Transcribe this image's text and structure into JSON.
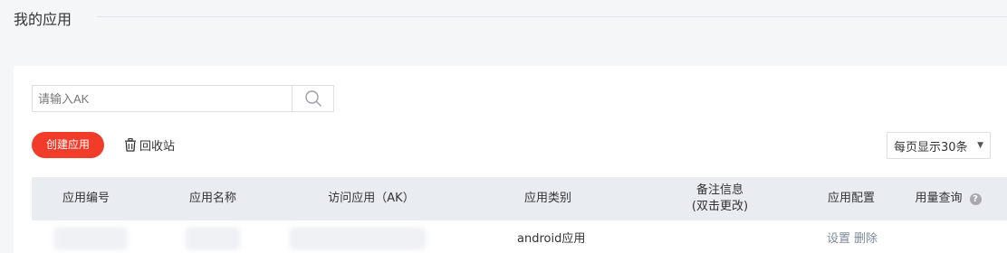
{
  "page": {
    "title": "我的应用"
  },
  "search": {
    "placeholder": "请输入AK",
    "value": ""
  },
  "toolbar": {
    "create_label": "创建应用",
    "recycle_label": "回收站",
    "page_size_label": "每页显示30条"
  },
  "table": {
    "columns": {
      "id": "应用编号",
      "name": "应用名称",
      "ak": "访问应用（AK）",
      "type": "应用类别",
      "remark_line1": "备注信息",
      "remark_line2": "(双击更改)",
      "config": "应用配置",
      "usage": "用量查询"
    },
    "rows": [
      {
        "type": "android应用",
        "settings_label": "设置",
        "delete_label": "删除"
      }
    ]
  },
  "colors": {
    "accent": "#f23c2a",
    "header_bg": "#e9ecf1",
    "link": "#7f8aa0"
  }
}
